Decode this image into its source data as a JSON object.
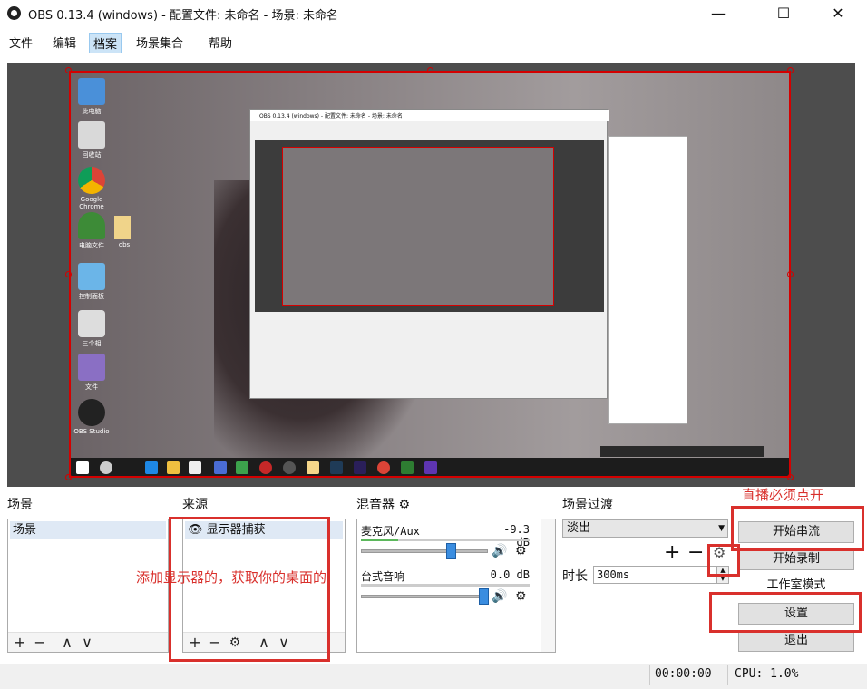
{
  "window": {
    "title": "OBS 0.13.4 (windows) - 配置文件: 未命名 - 场景: 未命名",
    "minimize": "—",
    "maximize": "☐",
    "close": "✕"
  },
  "menu": [
    {
      "label": "文件",
      "active": false
    },
    {
      "label": "编辑",
      "active": false
    },
    {
      "label": "档案",
      "active": true
    },
    {
      "label": "场景集合",
      "active": false
    },
    {
      "label": "帮助",
      "active": false
    }
  ],
  "preview": {
    "desktop_icons": [
      "此电脑",
      "回收站",
      "Google Chrome",
      "电脑文件",
      "obs",
      "控制面板",
      "三个相",
      "文件",
      "OBS Studio"
    ],
    "nested_title": "OBS 0.13.4 (windows) - 配置文件: 未命名 - 场景: 未命名"
  },
  "scenes": {
    "label": "场景",
    "items": [
      "场景"
    ]
  },
  "sources": {
    "label": "来源",
    "items": [
      "显示器捕获"
    ]
  },
  "mixer": {
    "label": "混音器",
    "channels": [
      {
        "name": "麦克风/Aux",
        "db": "-9.3 dB",
        "level": 0.22,
        "volume": 0.72
      },
      {
        "name": "台式音响",
        "db": "0.0 dB",
        "level": 0,
        "volume": 1.0
      }
    ]
  },
  "transitions": {
    "label": "场景过渡",
    "selected": "淡出",
    "duration_label": "时长",
    "duration": "300ms"
  },
  "controls": {
    "start_stream": "开始串流",
    "start_record": "开始录制",
    "studio_mode": "工作室模式",
    "settings": "设置",
    "exit": "退出"
  },
  "status": {
    "time": "00:00:00",
    "cpu": "CPU: 1.0%"
  },
  "annotations": {
    "stream_note": "直播必须点开",
    "source_note": "添加显示器的，获取你的桌面的"
  },
  "colors": {
    "annotation": "#d9302c",
    "selection": "#d40000",
    "slider": "#3a8de0"
  }
}
